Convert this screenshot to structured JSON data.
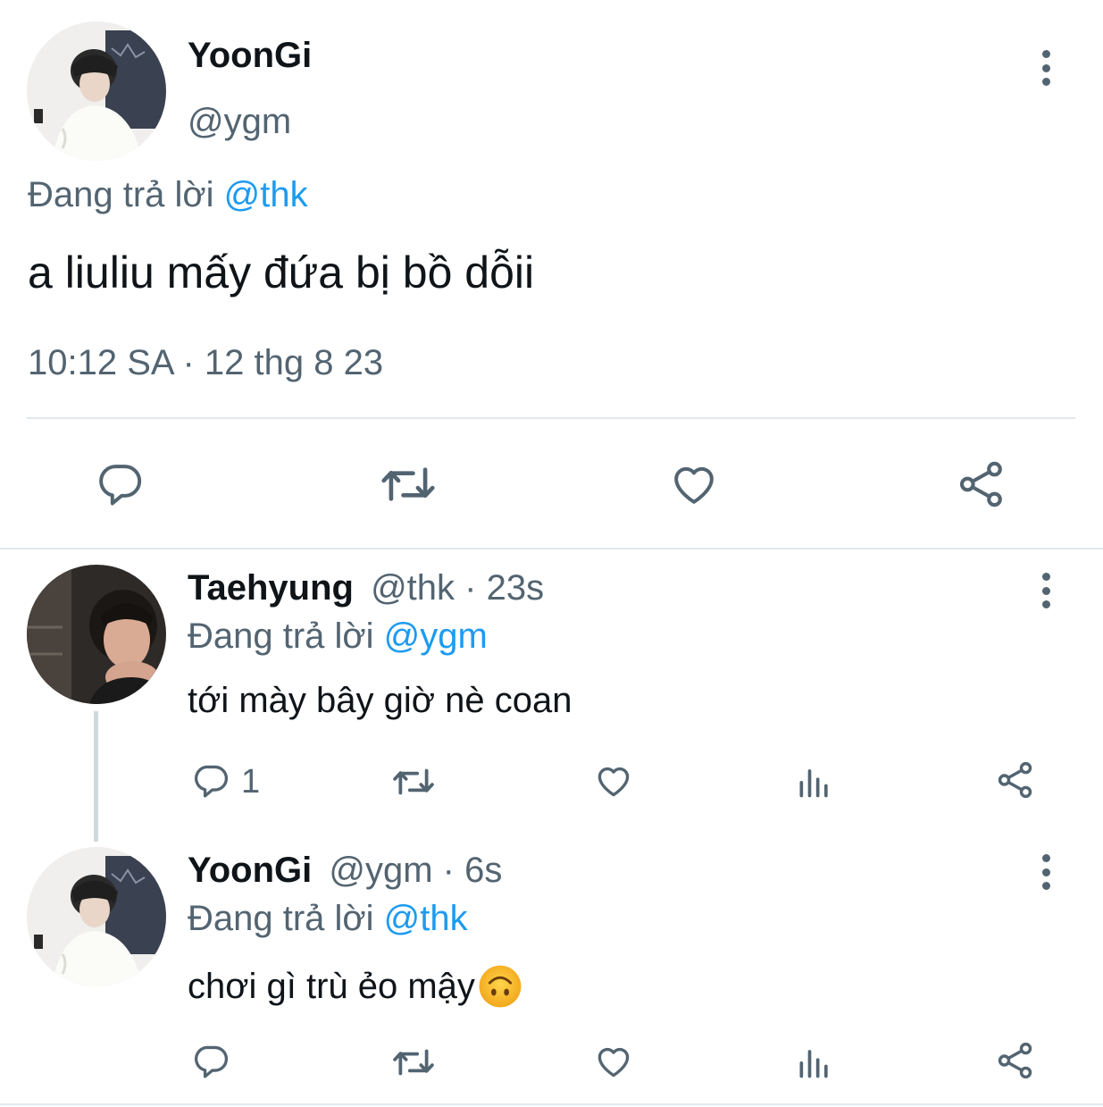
{
  "main_tweet": {
    "display_name": "YoonGi",
    "handle": "@ygm",
    "replying_prefix": "Đang trả lời",
    "replying_to": "@thk",
    "text": "a liuliu mấy đứa bị bồ dỗii",
    "timestamp": "10:12 SA · 12 thg 8 23",
    "actions": [
      "reply-icon",
      "retweet-icon",
      "like-icon",
      "share-icon"
    ]
  },
  "replies": [
    {
      "display_name": "Taehyung",
      "handle": "@thk",
      "sep": "·",
      "time": "23s",
      "replying_prefix": "Đang trả lời",
      "replying_to": "@ygm",
      "text": "tới mày bây giờ nè coan",
      "reply_count": "1"
    },
    {
      "display_name": "YoonGi",
      "handle": "@ygm",
      "sep": "·",
      "time": "6s",
      "replying_prefix": "Đang trả lời",
      "replying_to": "@thk",
      "text": "chơi gì trù ẻo mậy",
      "emoji": "upside-down-face"
    }
  ],
  "colors": {
    "accent": "#1d9bf0",
    "muted": "#536471",
    "text": "#0f1419",
    "divider": "#e1e8ed"
  }
}
